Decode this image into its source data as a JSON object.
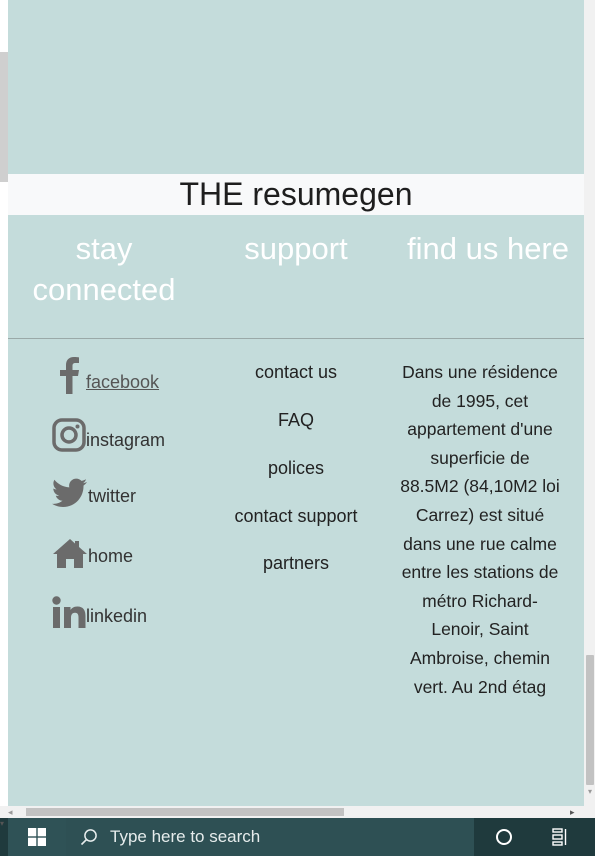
{
  "header": {
    "title": "THE resumegen"
  },
  "columns": {
    "stay_connected": "stay connected",
    "support": "support",
    "find_us": "find us here"
  },
  "social": [
    {
      "icon": "facebook-icon",
      "label": "facebook"
    },
    {
      "icon": "instagram-icon",
      "label": "instagram"
    },
    {
      "icon": "twitter-icon",
      "label": "twitter"
    },
    {
      "icon": "home-icon",
      "label": "home"
    },
    {
      "icon": "linkedin-icon",
      "label": "linkedin"
    }
  ],
  "support_links": [
    "contact us",
    "FAQ",
    "polices",
    "contact support",
    "partners"
  ],
  "address": "Dans une résidence de 1995, cet appartement d'une superficie de 88.5M2 (84,10M2 loi Carrez) est situé dans une rue calme entre les stations de métro Richard-Lenoir, Saint Ambroise, chemin vert. Au 2nd étag",
  "taskbar": {
    "search_placeholder": "Type here to search"
  },
  "colors": {
    "page_bg": "#c4dcdb",
    "title_bg": "#f8f9fa",
    "taskbar_bg": "#1f3a3d"
  }
}
